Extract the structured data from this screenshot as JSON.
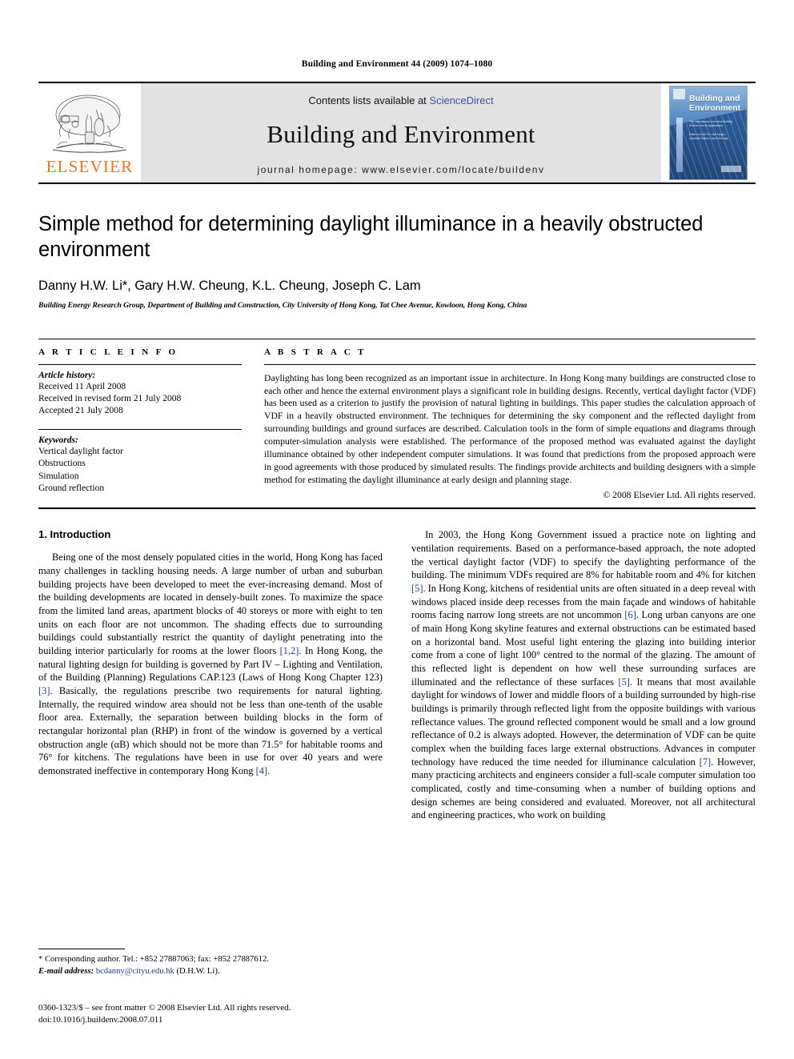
{
  "running_head": "Building and Environment 44 (2009) 1074–1080",
  "masthead": {
    "publisher_name": "ELSEVIER",
    "contents_prefix": "Contents lists available at ",
    "sciencedirect": "ScienceDirect",
    "journal_title": "Building and Environment",
    "homepage": "journal homepage: www.elsevier.com/locate/buildenv",
    "cover": {
      "title_line1": "Building and",
      "title_line2": "Environment",
      "subtitle": "The International Journal of Building Science and its Applications",
      "editors": "Editor-in-Chief: Per Olaf Fanger / Associate Editors: David Etheridge"
    },
    "link_color": "#3d53a4",
    "brand_color": "#E87722"
  },
  "article": {
    "title": "Simple method for determining daylight illuminance in a heavily obstructed environment",
    "authors": "Danny H.W. Li*, Gary H.W. Cheung, K.L. Cheung, Joseph C. Lam",
    "affiliation": "Building Energy Research Group, Department of Building and Construction, City University of Hong Kong, Tat Chee Avenue, Kowloon, Hong Kong, China"
  },
  "article_info": {
    "heading": "A R T I C L E   I N F O",
    "history_label": "Article history:",
    "history": [
      "Received 11 April 2008",
      "Received in revised form 21 July 2008",
      "Accepted 21 July 2008"
    ],
    "keywords_label": "Keywords:",
    "keywords": [
      "Vertical daylight factor",
      "Obstructions",
      "Simulation",
      "Ground reflection"
    ]
  },
  "abstract": {
    "heading": "A B S T R A C T",
    "text": "Daylighting has long been recognized as an important issue in architecture. In Hong Kong many buildings are constructed close to each other and hence the external environment plays a significant role in building designs. Recently, vertical daylight factor (VDF) has been used as a criterion to justify the provision of natural lighting in buildings. This paper studies the calculation approach of VDF in a heavily obstructed environment. The techniques for determining the sky component and the reflected daylight from surrounding buildings and ground surfaces are described. Calculation tools in the form of simple equations and diagrams through computer-simulation analysis were established. The performance of the proposed method was evaluated against the daylight illuminance obtained by other independent computer simulations. It was found that predictions from the proposed approach were in good agreements with those produced by simulated results. The findings provide architects and building designers with a simple method for estimating the daylight illuminance at early design and planning stage.",
    "copyright": "© 2008 Elsevier Ltd. All rights reserved."
  },
  "body": {
    "section_number_title": "1. Introduction",
    "left_paragraph_part1": "Being one of the most densely populated cities in the world, Hong Kong has faced many challenges in tackling housing needs. A large number of urban and suburban building projects have been developed to meet the ever-increasing demand. Most of the building developments are located in densely-built zones. To maximize the space from the limited land areas, apartment blocks of 40 storeys or more with eight to ten units on each floor are not uncommon. The shading effects due to surrounding buildings could substantially restrict the quantity of daylight penetrating into the building interior particularly for rooms at the lower floors ",
    "ref_1_2": "[1,2]",
    "left_paragraph_part2": ". In Hong Kong, the natural lighting design for building is governed by Part IV – Lighting and Ventilation, of the Building (Planning) Regulations CAP.123 (Laws of Hong Kong Chapter 123) ",
    "ref_3": "[3]",
    "left_paragraph_part3": ". Basically, the regulations prescribe two requirements for natural lighting. Internally, the required window area should not be less than one-tenth of the usable floor area. Externally, the separation between building blocks in the form of rectangular horizontal plan (RHP) in front of the window is governed by a vertical obstruction angle (αB) which should not be more than 71.5° for habitable rooms and 76° for kitchens. The regulations have been in use for over 40 years and were demonstrated ineffective in contemporary Hong Kong ",
    "ref_4": "[4]",
    "left_paragraph_part4": ".",
    "right_paragraph_part1": "In 2003, the Hong Kong Government issued a practice note on lighting and ventilation requirements. Based on a performance-based approach, the note adopted the vertical daylight factor (VDF) to specify the daylighting performance of the building. The minimum VDFs required are 8% for habitable room and 4% for kitchen ",
    "ref_5a": "[5]",
    "right_paragraph_part2": ". In Hong Kong, kitchens of residential units are often situated in a deep reveal with windows placed inside deep recesses from the main façade and windows of habitable rooms facing narrow long streets are not uncommon ",
    "ref_6": "[6]",
    "right_paragraph_part3": ". Long urban canyons are one of main Hong Kong skyline features and external obstructions can be estimated based on a horizontal band. Most useful light entering the glazing into building interior come from a cone of light 100° centred to the normal of the glazing. The amount of this reflected light is dependent on how well these surrounding surfaces are illuminated and the reflectance of these surfaces ",
    "ref_5b": "[5]",
    "right_paragraph_part4": ". It means that most available daylight for windows of lower and middle floors of a building surrounded by high-rise buildings is primarily through reflected light from the opposite buildings with various reflectance values. The ground reflected component would be small and a low ground reflectance of 0.2 is always adopted. However, the determination of VDF can be quite complex when the building faces large external obstructions. Advances in computer technology have reduced the time needed for illuminance calculation ",
    "ref_7": "[7]",
    "right_paragraph_part5": ". However, many practicing architects and engineers consider a full-scale computer simulation too complicated, costly and time-consuming when a number of building options and design schemes are being considered and evaluated. Moreover, not all architectural and engineering practices, who work on building"
  },
  "footnote": {
    "corresponding": "* Corresponding author. Tel.: +852 27887063; fax: +852 27887612.",
    "email_label": "E-mail address:",
    "email": "bcdanny@cityu.edu.hk",
    "email_suffix": "(D.H.W. Li).",
    "imprint_line1": "0360-1323/$ – see front matter © 2008 Elsevier Ltd. All rights reserved.",
    "imprint_line2": "doi:10.1016/j.buildenv.2008.07.011"
  }
}
